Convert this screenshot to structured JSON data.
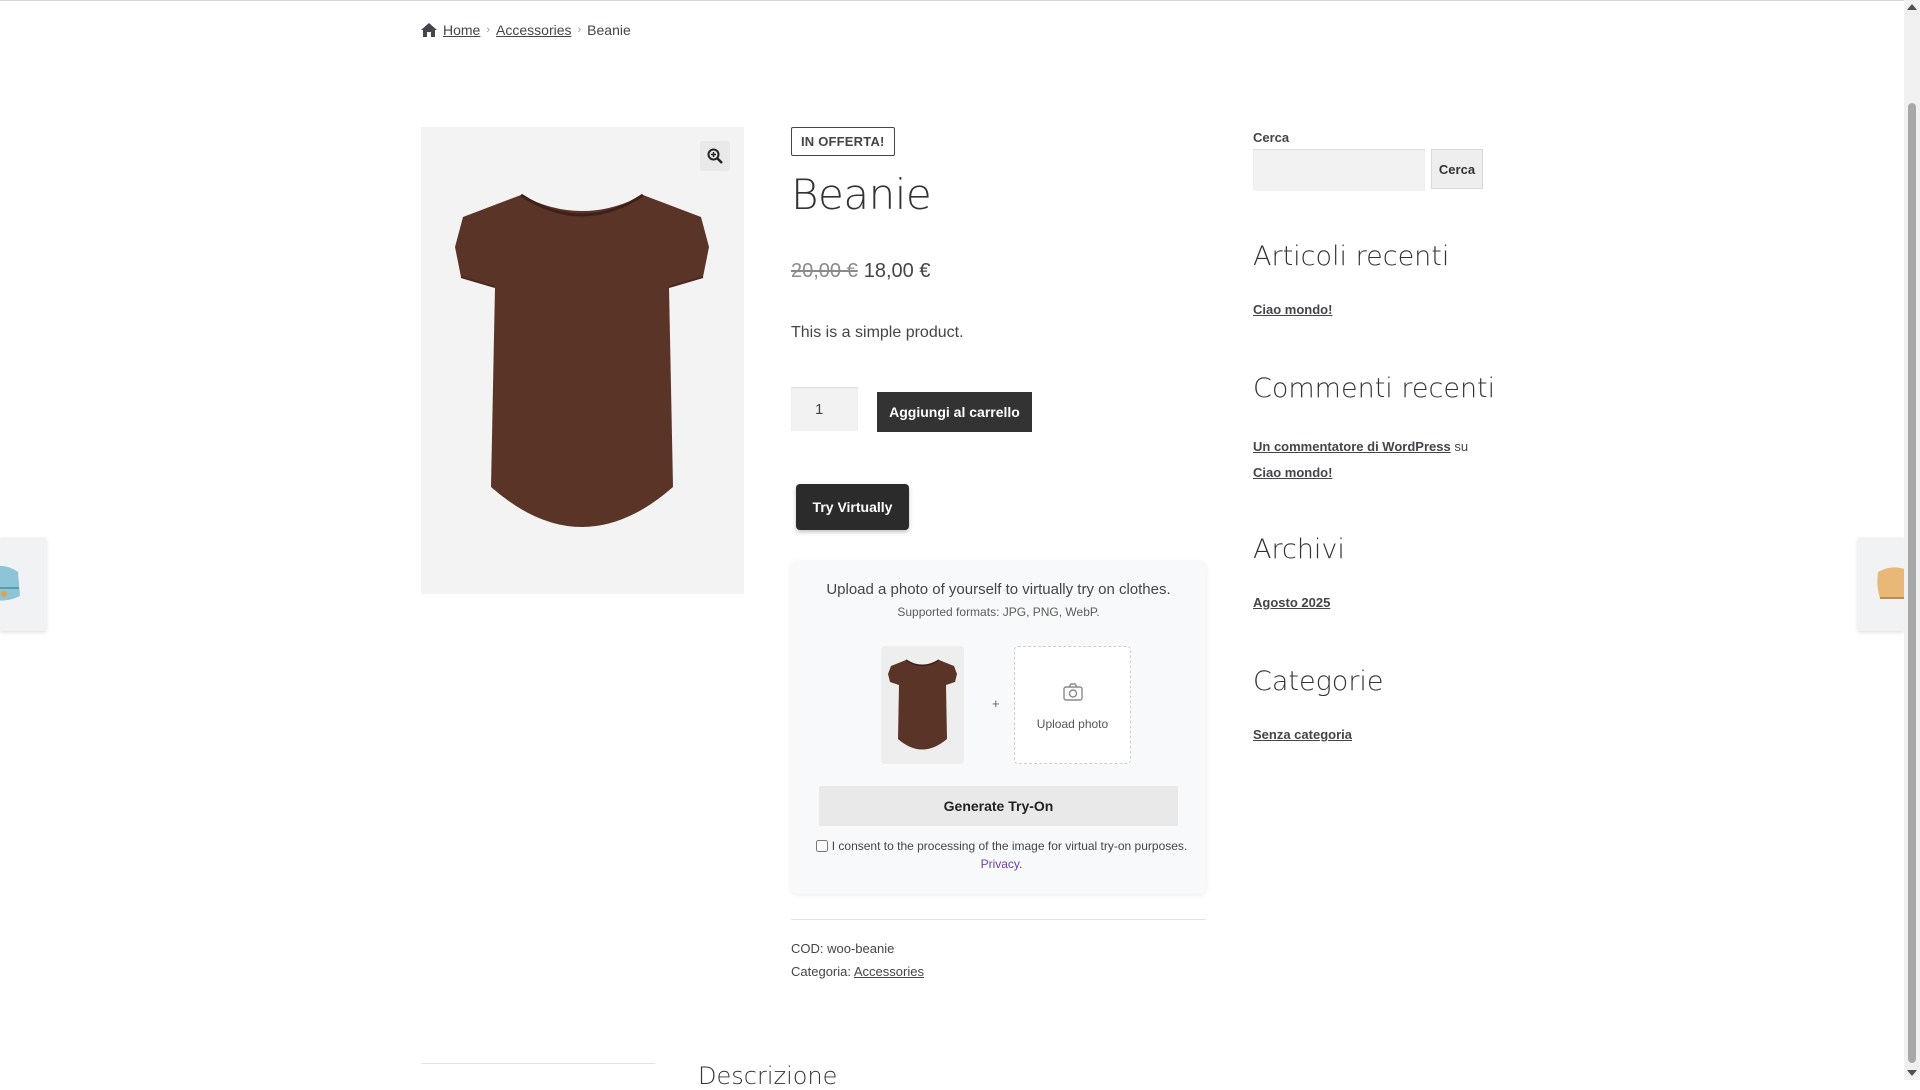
{
  "breadcrumb": {
    "home": "Home",
    "category": "Accessories",
    "current": "Beanie"
  },
  "product": {
    "badge": "IN OFFERTA!",
    "title": "Beanie",
    "old_price": "20,00 €",
    "price": "18,00 €",
    "short_description": "This is a simple product.",
    "quantity": "1",
    "add_to_cart": "Aggiungi al carrello",
    "image_color": "#5b3428"
  },
  "tryon": {
    "button": "Try Virtually",
    "title": "Upload a photo of yourself to virtually try on clothes.",
    "formats": "Supported formats: JPG, PNG, WebP.",
    "plus": "+",
    "upload_label": "Upload photo",
    "generate": "Generate Try-On",
    "consent": "I consent to the processing of the image for virtual try-on purposes.",
    "privacy": "Privacy",
    "privacy_suffix": "."
  },
  "meta": {
    "sku_label": "COD:",
    "sku": "woo-beanie",
    "category_label": "Categoria:",
    "category": "Accessories"
  },
  "tabs": {
    "description": "Descrizione"
  },
  "sidebar": {
    "search_label": "Cerca",
    "search_button": "Cerca",
    "recent_posts_title": "Articoli recenti",
    "recent_post": "Ciao mondo!",
    "recent_comments_title": "Commenti recenti",
    "comment_author": "Un commentatore di WordPress",
    "comment_on": "su",
    "comment_post": "Ciao mondo!",
    "archives_title": "Archivi",
    "archive": "Agosto 2025",
    "categories_title": "Categorie",
    "category": "Senza categoria"
  }
}
